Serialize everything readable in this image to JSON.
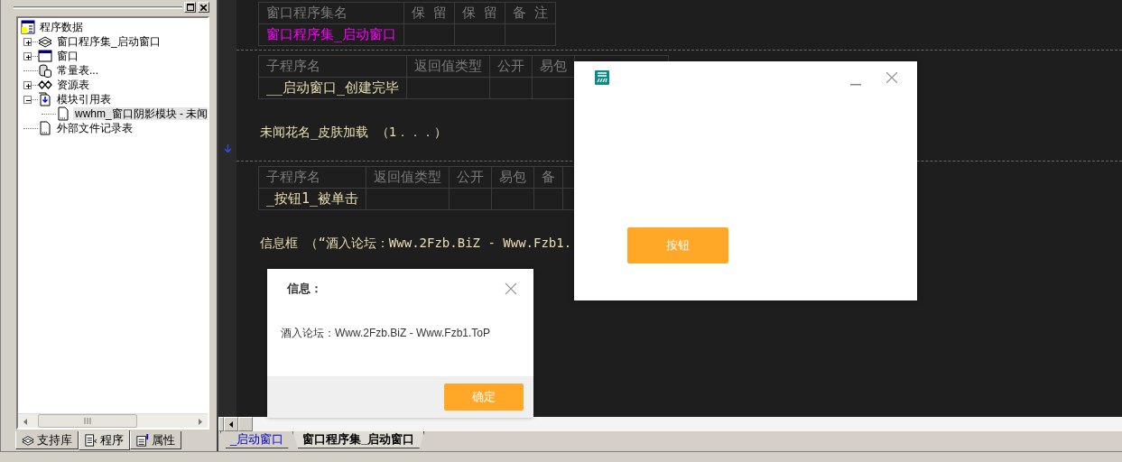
{
  "side_panel": {
    "tree": [
      {
        "label": "程序数据",
        "selected": false,
        "children": [
          {
            "label": "窗口程序集_启动窗口",
            "selected": false,
            "expanded": false
          },
          {
            "label": "窗口",
            "selected": false,
            "expanded": false
          },
          {
            "label": "常量表...",
            "selected": false
          },
          {
            "label": "资源表",
            "selected": false,
            "expanded": false
          },
          {
            "label": "模块引用表",
            "selected": false,
            "expanded": true,
            "children": [
              {
                "label": "wwhm_窗口阴影模块 - 未闻",
                "selected": true
              }
            ]
          },
          {
            "label": "外部文件记录表",
            "selected": false
          }
        ]
      }
    ],
    "tabs": [
      {
        "label": "支持库",
        "selected": false
      },
      {
        "label": "程序",
        "selected": true
      },
      {
        "label": "属性",
        "selected": false
      }
    ]
  },
  "editor": {
    "blocks": [
      {
        "kind": "class_table",
        "columns": [
          "窗口程序集名",
          "保 留",
          "保 留",
          "备 注"
        ],
        "rows": [
          {
            "name": "窗口程序集_启动窗口"
          }
        ]
      },
      {
        "kind": "divider"
      },
      {
        "kind": "sub_table",
        "columns": [
          "子程序名",
          "返回值类型",
          "公开",
          "易包"
        ],
        "rows": [
          {
            "name": "__启动窗口_创建完毕"
          }
        ]
      },
      {
        "kind": "code_line",
        "text": "未闻花名_皮肤加载 （1．．．）"
      },
      {
        "kind": "divider"
      },
      {
        "kind": "sub_table",
        "columns": [
          "子程序名",
          "返回值类型",
          "公开",
          "易包",
          "备"
        ],
        "rows": [
          {
            "name": "_按钮1_被单击"
          }
        ]
      },
      {
        "kind": "code_line",
        "text": "信息框 （“酒入论坛：Www.2Fzb.BiZ - Www.Fzb1."
      }
    ],
    "tabs": [
      {
        "label": "_启动窗口",
        "selected": false
      },
      {
        "label": "窗口程序集_启动窗口",
        "selected": true
      }
    ]
  },
  "app_window": {
    "button": "按钮"
  },
  "message_box": {
    "title": "信息：",
    "message": "酒入论坛：Www.2Fzb.BiZ - Www.Fzb1.ToP",
    "button": "确定"
  }
}
